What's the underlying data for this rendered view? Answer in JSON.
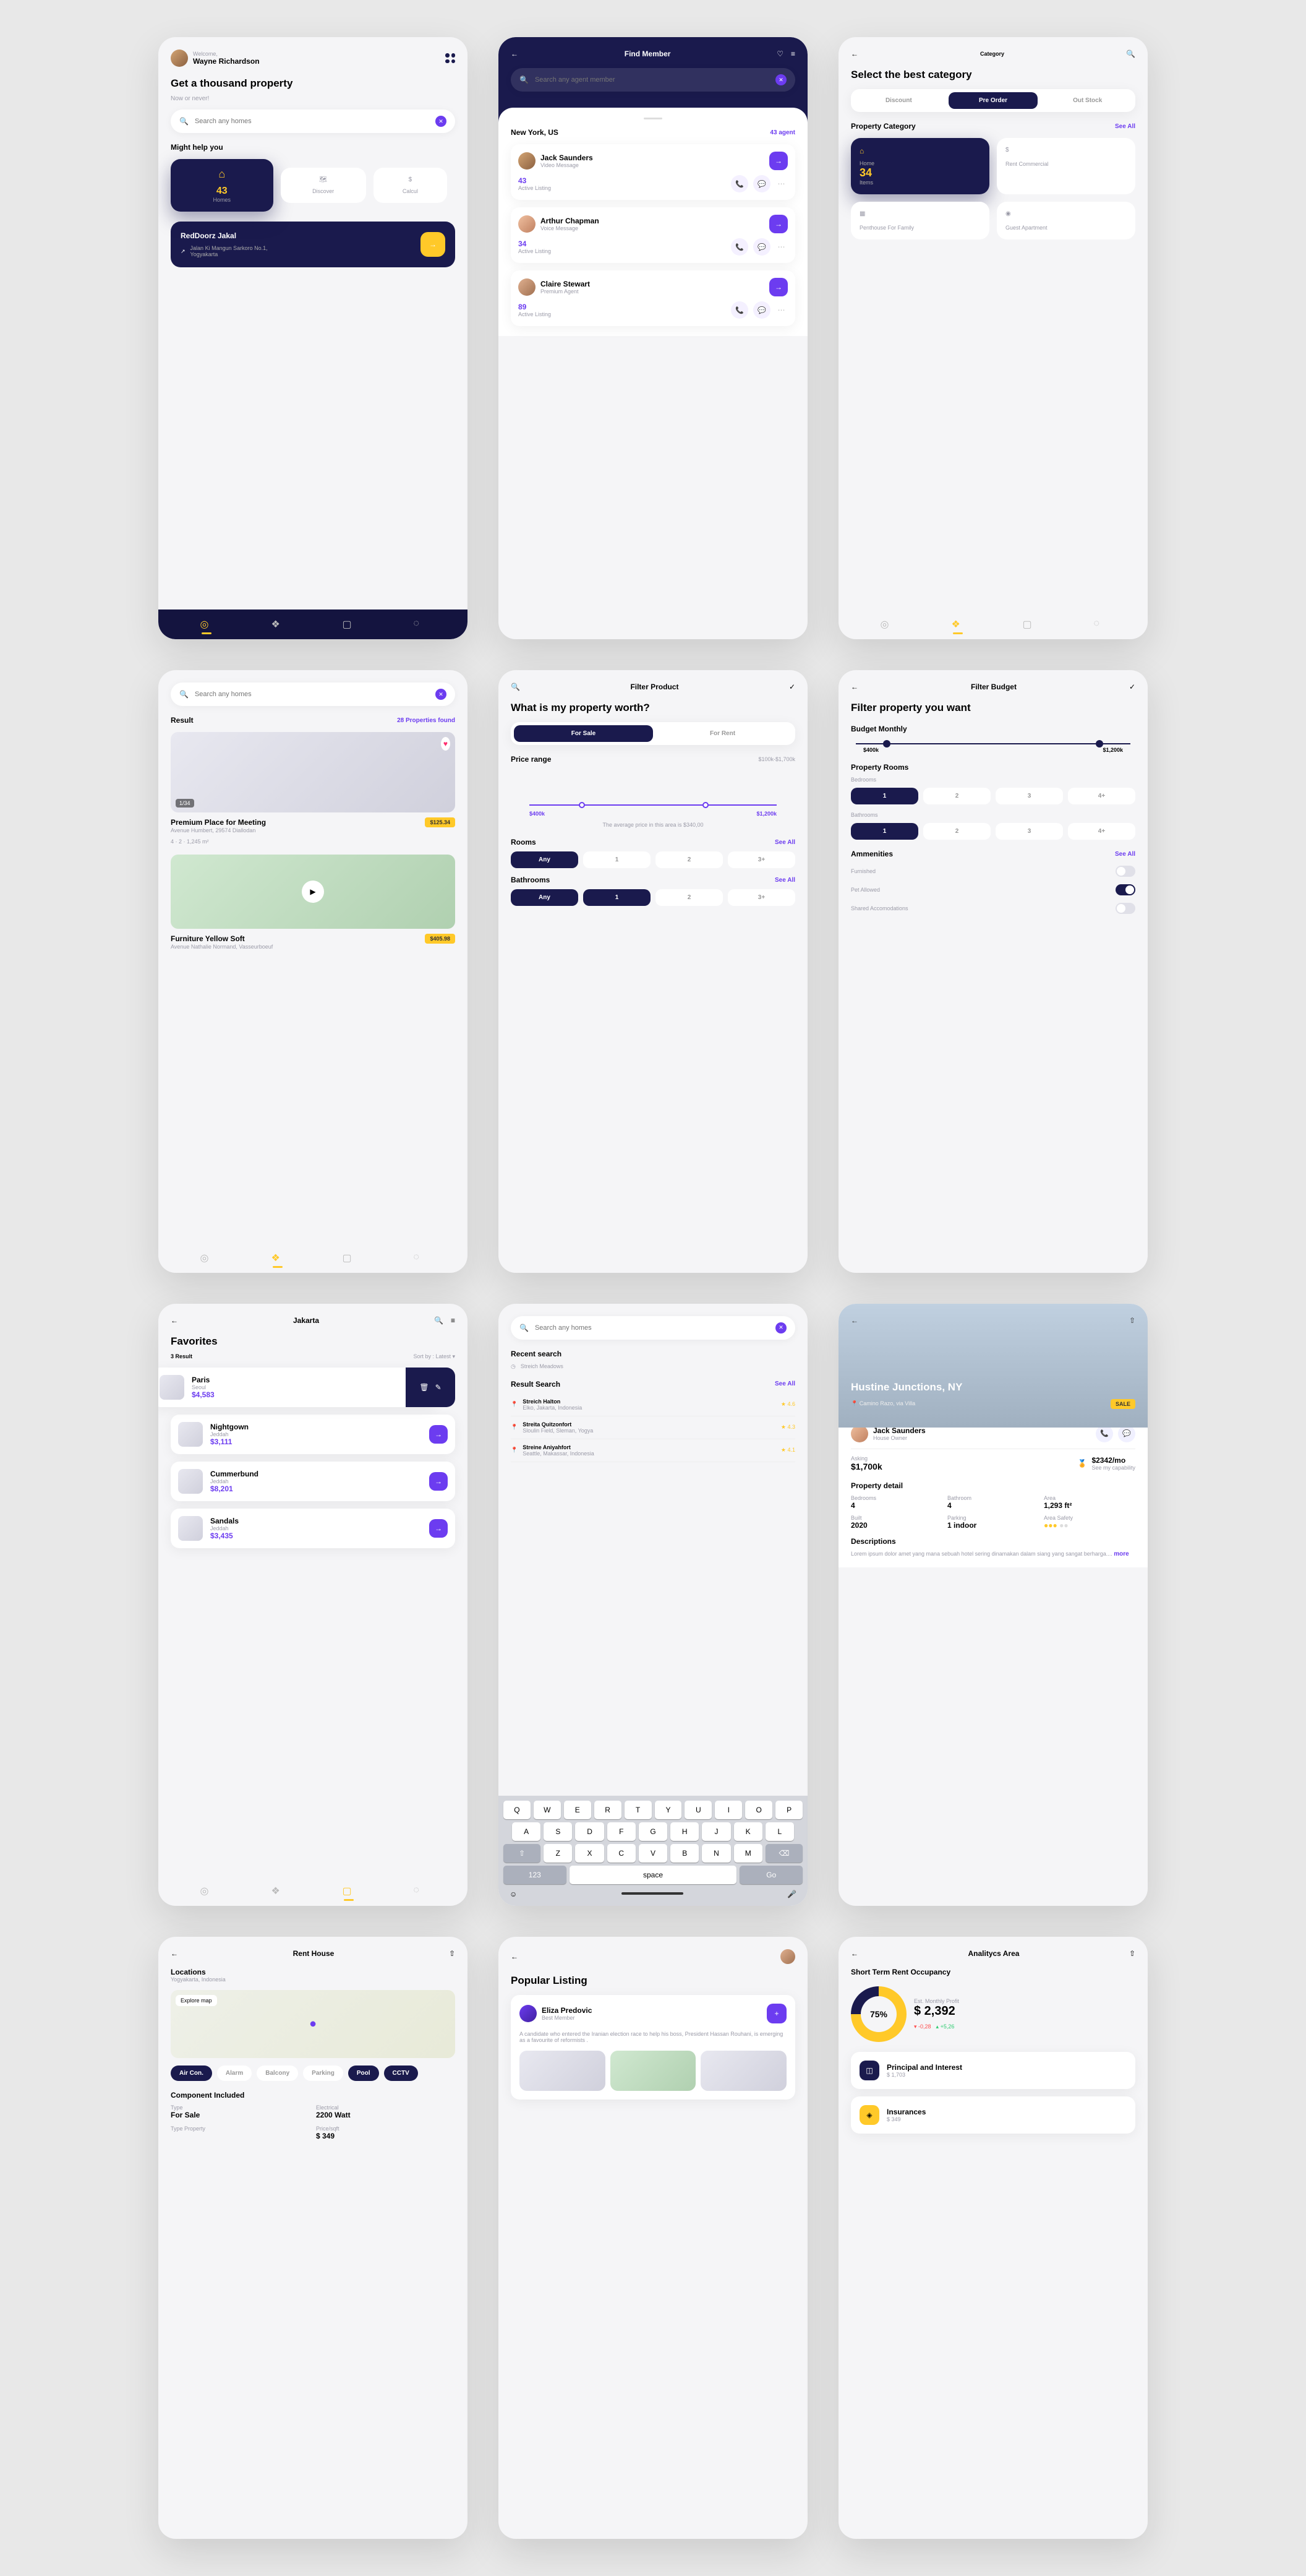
{
  "s1": {
    "welcome": "Welcome,",
    "name": "Wayne Richardson",
    "title": "Get a thousand property",
    "sub": "Now or never!",
    "searchPh": "Search any homes",
    "help": "Might help you",
    "hcount": "43",
    "hlabel": "Homes",
    "t2": "Discover",
    "t3": "Calcul",
    "featured": "RedDoorz Jakal",
    "addr": "Jalan Ki Mangun Sarkoro No.1, Yogyakarta"
  },
  "s2": {
    "title": "Find Member",
    "searchPh": "Search any agent member",
    "loc": "New York, US",
    "agents": "43 agent",
    "list": [
      {
        "name": "Jack Saunders",
        "sub": "Video Message",
        "n": "43",
        "al": "Active Listing"
      },
      {
        "name": "Arthur Chapman",
        "sub": "Voice Message",
        "n": "34",
        "al": "Active Listing"
      },
      {
        "name": "Claire Stewart",
        "sub": "Premium Agent",
        "n": "89",
        "al": "Active Listing"
      }
    ]
  },
  "s3": {
    "header": "Category",
    "title": "Select the best category",
    "tabs": [
      "Discount",
      "Pre Order",
      "Out Stock"
    ],
    "sec": "Property Category",
    "see": "See All",
    "c1t": "Home",
    "c1n": "34",
    "c1l": "Items",
    "c2t": "Rent Commercial",
    "c3t": "Penthouse For Family",
    "c4t": "Guest Apartment"
  },
  "s4": {
    "searchPh": "Search any homes",
    "res": "Result",
    "found": "28 Properties found",
    "p1": "Premium Place for Meeting",
    "p1a": "Avenue Humbert, 29574 Diallodan",
    "p1p": "$125.34",
    "p1s": "4 · 2 · 1,245 m²",
    "p2": "Furniture Yellow Soft",
    "p2a": "Avenue Nathalie Normand, Vasseurboeuf",
    "p2p": "$405.98"
  },
  "s5": {
    "header": "Filter Product",
    "title": "What is my property worth?",
    "t1": "For Sale",
    "t2": "For Rent",
    "pr": "Price range",
    "prv": "$100k-$1,700k",
    "lo": "$400k",
    "hi": "$1,200k",
    "avg": "The average price in this area is $340,00",
    "rooms": "Rooms",
    "baths": "Bathrooms",
    "see": "See All",
    "opts": [
      "Any",
      "1",
      "2",
      "3+"
    ]
  },
  "s6": {
    "header": "Filter Budget",
    "title": "Filter property you want",
    "bm": "Budget Monthly",
    "lo": "$400k",
    "hi": "$1,200k",
    "pr": "Property Rooms",
    "bed": "Bedrooms",
    "bath": "Bathrooms",
    "opts": [
      "1",
      "2",
      "3",
      "4+"
    ],
    "am": "Ammenities",
    "see": "See All",
    "a1": "Furnished",
    "a2": "Pet Allowed",
    "a3": "Shared Accomodations"
  },
  "s7": {
    "header": "Jakarta",
    "title": "Favorites",
    "count": "3 Result",
    "sort": "Sort by : Latest",
    "items": [
      {
        "name": "Paris",
        "sub": "Seoul",
        "price": "$4,583"
      },
      {
        "name": "Nightgown",
        "sub": "Jeddah",
        "price": "$3,111"
      },
      {
        "name": "Cummerbund",
        "sub": "Jeddah",
        "price": "$8,201"
      },
      {
        "name": "Sandals",
        "sub": "Jeddah",
        "price": "$3,435"
      }
    ]
  },
  "s8": {
    "searchPh": "Search any homes",
    "rs": "Recent search",
    "r1": "Streich Meadows",
    "rsec": "Result Search",
    "see": "See All",
    "items": [
      {
        "n": "Streich Halton",
        "s": "Elko, Jakarta, Indonesia",
        "r": "4.6"
      },
      {
        "n": "Streita Quitzonfort",
        "s": "Sloulin Field, Sleman, Yogya",
        "r": "4.3"
      },
      {
        "n": "Streine Aniyahfort",
        "s": "Seattle, Makassar, Indonesia",
        "r": "4.1"
      }
    ],
    "space": "space",
    "go": "Go",
    "num": "123"
  },
  "s9": {
    "title": "Hustine Junctions, NY",
    "addr": "Camino Razo, via Villa",
    "sale": "SALE",
    "owner": "Jack Saunders",
    "role": "House Owner",
    "ask": "Asking",
    "askv": "$1,700k",
    "mo": "$2342/mo",
    "cap": "See my capability",
    "pd": "Property detail",
    "bed": "Bedrooms",
    "bedv": "4",
    "bath": "Bathroom",
    "bathv": "4",
    "area": "Area",
    "areav": "1,293 ft²",
    "built": "Built",
    "builtv": "2020",
    "park": "Parking",
    "parkv": "1 indoor",
    "safe": "Area Safety",
    "desc": "Descriptions",
    "body": "Lorem ipsum dolor amet yang mana sebuah hotel sering dinamakan dalam siang yang sangat berharga....",
    "more": "more"
  },
  "s10": {
    "header": "Rent House",
    "loc": "Locations",
    "locv": "Yogyakarta, Indonesia",
    "exp": "Explore map",
    "chips": [
      "Air Con.",
      "Alarm",
      "Balcony",
      "Parking",
      "Pool",
      "CCTV"
    ],
    "comp": "Component Included",
    "type": "Type",
    "typev": "For Sale",
    "elec": "Electrical",
    "elecv": "2200 Watt",
    "tp": "Type Property",
    "psqft": "Price/sqft",
    "psqftv": "$ 349"
  },
  "s11": {
    "title": "Popular Listing",
    "name": "Eliza Predovic",
    "role": "Best Member",
    "body": "A candidate who entered the Iranian election race to help his boss, President Hassan Rouhani, is emerging as a favourite of reformists ."
  },
  "s12": {
    "header": "Analitycs Area",
    "sec": "Short Term Rent Occupancy",
    "pct": "75%",
    "est": "Est. Monthly Profit",
    "val": "$ 2,392",
    "d1": "-0,28",
    "d2": "+5,26",
    "i1": "Principal and Interest",
    "i1v": "$ 1,703",
    "i2": "Insurances",
    "i2v": "$ 349"
  }
}
